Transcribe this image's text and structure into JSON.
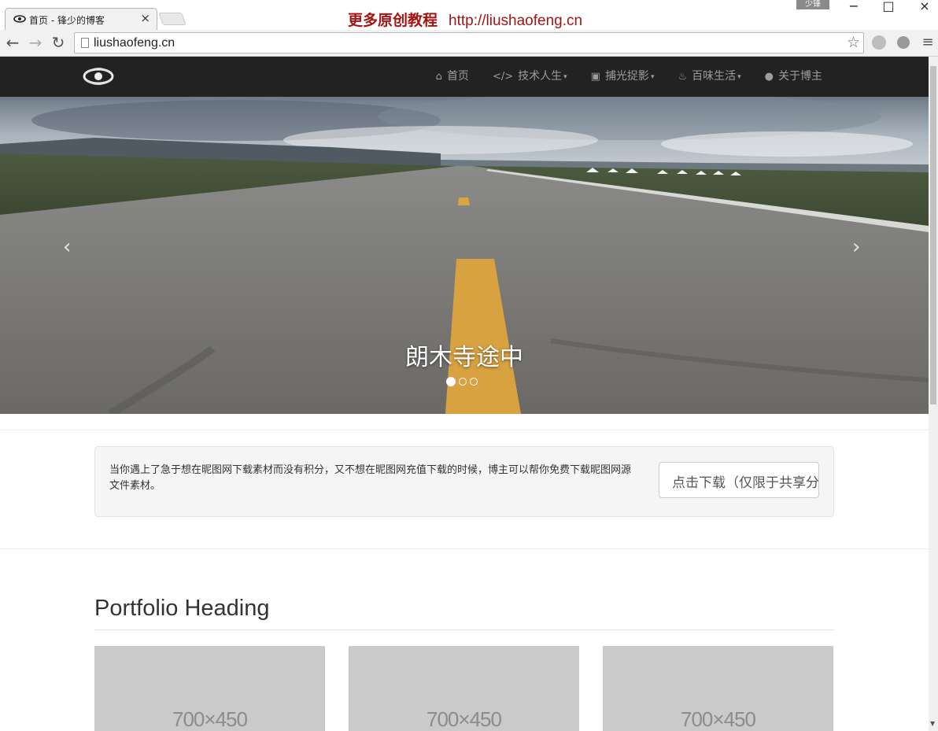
{
  "browser": {
    "tab_title": "首页 - 锋少的博客",
    "tab_close": "×",
    "promo_text": "更多原创教程",
    "promo_url": "http://liushaofeng.cn",
    "user_badge": "少锋",
    "window_controls": {
      "minimize": "−",
      "maximize": "□",
      "close": "×"
    },
    "url": "liushaofeng.cn",
    "nav": {
      "back": "←",
      "forward": "→",
      "reload": "↻",
      "star": "☆",
      "menu": "≡"
    }
  },
  "site": {
    "nav": [
      {
        "icon": "home-icon",
        "glyph": "⌂",
        "label": "首页",
        "dropdown": false
      },
      {
        "icon": "code-icon",
        "glyph": "</>",
        "label": "技术人生",
        "dropdown": true
      },
      {
        "icon": "picture-icon",
        "glyph": "▣",
        "label": "捕光捉影",
        "dropdown": true
      },
      {
        "icon": "cutlery-icon",
        "glyph": "♨",
        "label": "百味生活",
        "dropdown": true
      },
      {
        "icon": "user-icon",
        "glyph": "●",
        "label": "关于博主",
        "dropdown": false
      }
    ],
    "caret": "▾",
    "carousel": {
      "caption": "朗木寺途中",
      "prev": "‹",
      "next": "›",
      "slides": 3,
      "active_slide": 1
    },
    "well": {
      "text": "当你遇上了急于想在昵图网下载素材而没有积分，又不想在昵图网充值下载的时候，博主可以帮你免费下载昵图网源文件素材。",
      "button": "点击下载（仅限于共享分）"
    },
    "portfolio": {
      "heading": "Portfolio Heading",
      "items": [
        "700×450",
        "700×450",
        "700×450"
      ]
    }
  },
  "colors": {
    "navbar": "#222222",
    "nav_text": "#9d9d9d",
    "promo": "#a31515",
    "placeholder": "#cbcacb"
  }
}
